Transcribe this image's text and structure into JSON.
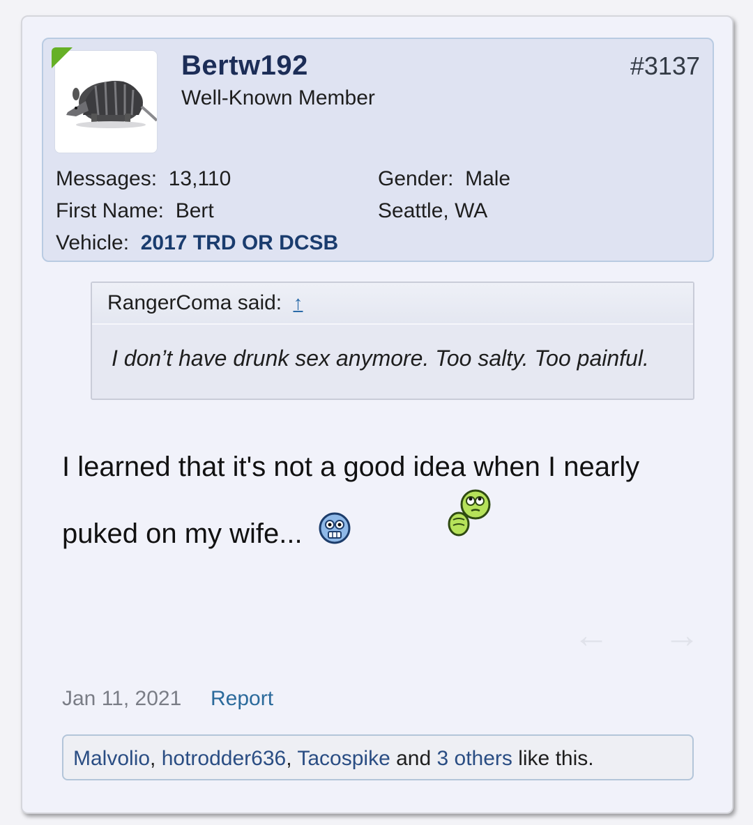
{
  "post": {
    "username": "Bertw192",
    "user_title": "Well-Known Member",
    "post_number": "#3137",
    "stats": {
      "messages_label": "Messages:",
      "messages_value": "13,110",
      "first_name_label": "First Name:",
      "first_name_value": "Bert",
      "vehicle_label": "Vehicle:",
      "vehicle_value": "2017 TRD OR DCSB",
      "gender_label": "Gender:",
      "gender_value": "Male",
      "location": "Seattle, WA"
    },
    "quote": {
      "author_said": "RangerComa said:",
      "jump_arrow": "↑",
      "text": "I don’t have drunk sex anymore. Too salty. Too painful."
    },
    "message_line1": "I learned that it's not a good idea when I nearly",
    "message_line2": "puked on my wife...",
    "nav": {
      "prev": "←",
      "next": "→"
    },
    "date": "Jan 11, 2021",
    "report_label": "Report",
    "likes": {
      "user1": "Malvolio",
      "sep1": ", ",
      "user2": "hotrodder636",
      "sep2": ", ",
      "user3": "Tacospike",
      "and": " and ",
      "others": "3 others",
      "tail": " like this."
    }
  },
  "icons": {
    "avatar": "armadillo-avatar",
    "emoji1": "scared-face-emoji",
    "emoji2": "puking-smiley-emoji"
  },
  "colors": {
    "username": "#1c2d57",
    "link": "#2b6a9b",
    "online": "#66b026"
  }
}
